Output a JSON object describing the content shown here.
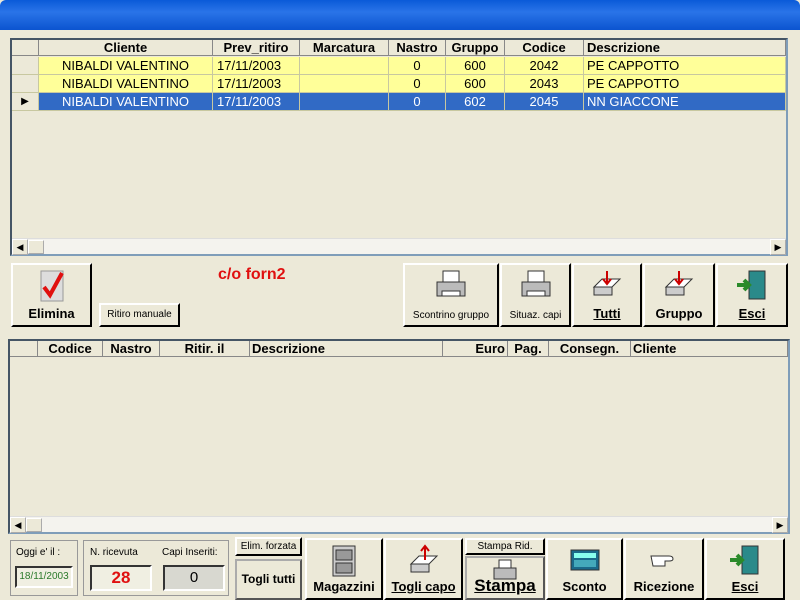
{
  "top_grid": {
    "columns": [
      "Cliente",
      "Prev_ritiro",
      "Marcatura",
      "Nastro",
      "Gruppo",
      "Codice",
      "Descrizione"
    ],
    "rows": [
      {
        "cliente": "NIBALDI VALENTINO",
        "prev": "17/11/2003",
        "marc": "",
        "nastro": "0",
        "gruppo": "600",
        "codice": "2042",
        "desc": "PE CAPPOTTO"
      },
      {
        "cliente": "NIBALDI VALENTINO",
        "prev": "17/11/2003",
        "marc": "",
        "nastro": "0",
        "gruppo": "600",
        "codice": "2043",
        "desc": "PE CAPPOTTO"
      },
      {
        "cliente": "NIBALDI VALENTINO",
        "prev": "17/11/2003",
        "marc": "",
        "nastro": "0",
        "gruppo": "602",
        "codice": "2045",
        "desc": "NN GIACCONE"
      }
    ],
    "selected_row": 2
  },
  "mid": {
    "status_text": "c/o forn2",
    "elimina": "Elimina",
    "ritiro_manuale": "Ritiro manuale",
    "scontrino_gruppo": "Scontrino gruppo",
    "situaz_capi": "Situaz. capi",
    "tutti": "Tutti",
    "gruppo": "Gruppo",
    "esci": "Esci"
  },
  "bottom_grid": {
    "columns": [
      "Codice",
      "Nastro",
      "Ritir. il",
      "Descrizione",
      "Euro",
      "Pag.",
      "Consegn.",
      "Cliente"
    ]
  },
  "footer": {
    "oggi_label": "Oggi e' il :",
    "oggi_value": "18/11/2003",
    "ricevuta_label": "N. ricevuta",
    "ricevuta_value": "28",
    "capi_label": "Capi Inseriti:",
    "capi_value": "0",
    "elim_forzata": "Elim. forzata",
    "togli_tutti": "Togli tutti",
    "magazzini": "Magazzini",
    "togli_capo": "Togli capo",
    "stampa_rid": "Stampa Rid.",
    "stampa": "Stampa",
    "sconto": "Sconto",
    "ricezione": "Ricezione",
    "esci": "Esci"
  },
  "colors": {
    "accent": "#316ac5",
    "highlight_row": "#ffff99",
    "status_red": "#e01010"
  }
}
